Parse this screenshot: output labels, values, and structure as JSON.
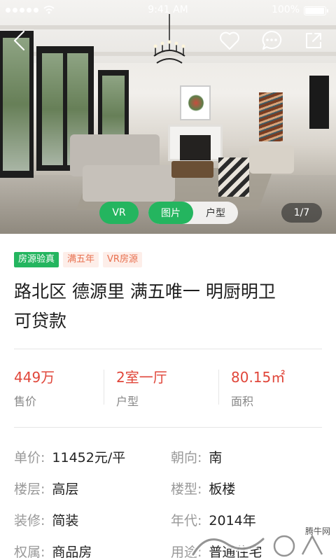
{
  "status_bar": {
    "time": "9:41 AM",
    "battery": "100%",
    "battery_level": 1.0,
    "signal_strength": 5,
    "icons": [
      "signal-icon",
      "wifi-icon",
      "battery-icon"
    ]
  },
  "nav": {
    "icons": [
      "back-arrow-icon",
      "heart-icon",
      "chat-bubble-icon",
      "share-icon"
    ]
  },
  "gallery": {
    "segments": {
      "vr": "VR",
      "photos": "图片",
      "floorplan": "户型"
    },
    "active_segment": "photos",
    "counter": "1/7"
  },
  "tags": [
    {
      "label": "房源验真",
      "style": "green"
    },
    {
      "label": "满五年",
      "style": "pink"
    },
    {
      "label": "VR房源",
      "style": "pink"
    }
  ],
  "listing": {
    "title_line1": "路北区 德源里 满五唯一 明厨明卫",
    "title_line2": "可贷款"
  },
  "summary": [
    {
      "value": "449万",
      "label": "售价"
    },
    {
      "value": "2室一厅",
      "label": "户型"
    },
    {
      "value": "80.15㎡",
      "label": "面积"
    }
  ],
  "details": [
    {
      "key": "单价:",
      "value": "11452元/平"
    },
    {
      "key": "朝向:",
      "value": "南"
    },
    {
      "key": "楼层:",
      "value": "高层"
    },
    {
      "key": "楼型:",
      "value": "板楼"
    },
    {
      "key": "装修:",
      "value": "简装"
    },
    {
      "key": "年代:",
      "value": "2014年"
    },
    {
      "key": "权属:",
      "value": "商品房"
    },
    {
      "key": "用途:",
      "value": "普通住宅"
    }
  ],
  "watermark": {
    "text": "腾牛网"
  },
  "colors": {
    "accent_green": "#24b55f",
    "price_red": "#e0463a",
    "tag_pink_text": "#e8704f"
  }
}
